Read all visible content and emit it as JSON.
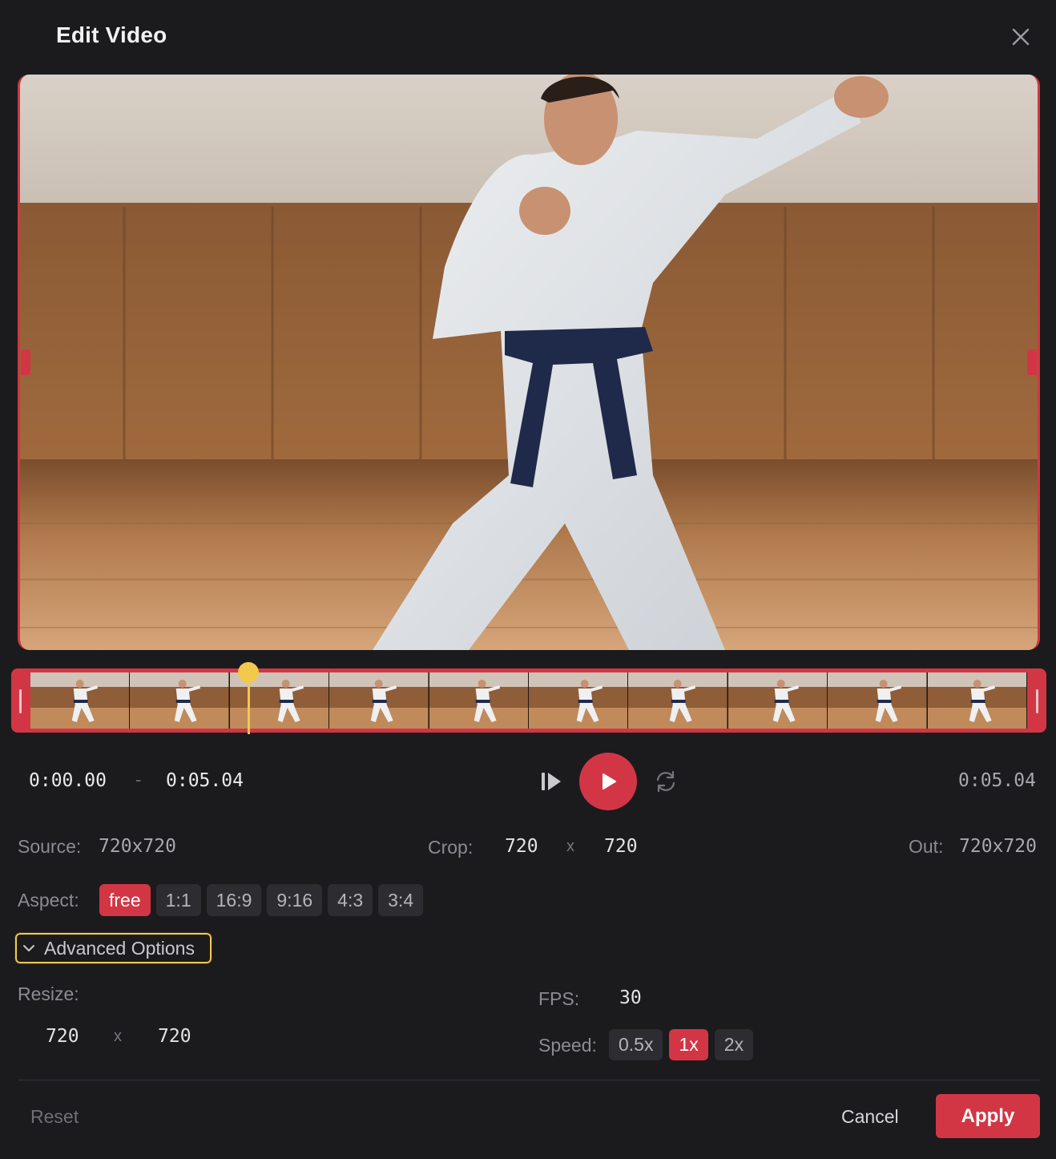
{
  "dialog": {
    "title": "Edit Video",
    "close_icon": "close-icon"
  },
  "playback": {
    "start_time": "0:00.00",
    "range_separator": "-",
    "end_time": "0:05.04",
    "total_duration": "0:05.04",
    "playhead_fraction": 0.22
  },
  "timeline": {
    "frame_count": 10
  },
  "info": {
    "source_label": "Source:",
    "source_value": "720x720",
    "crop_label": "Crop:",
    "crop_width": "720",
    "crop_separator": "x",
    "crop_height": "720",
    "out_label": "Out:",
    "out_value": "720x720"
  },
  "aspect": {
    "label": "Aspect:",
    "options": [
      "free",
      "1:1",
      "16:9",
      "9:16",
      "4:3",
      "3:4"
    ],
    "selected": "free"
  },
  "advanced": {
    "toggle_label": "Advanced Options",
    "expanded": true,
    "resize_label": "Resize:",
    "resize_width": "720",
    "resize_separator": "x",
    "resize_height": "720",
    "fps_label": "FPS:",
    "fps_value": "30",
    "speed_label": "Speed:",
    "speed_options": [
      "0.5x",
      "1x",
      "2x"
    ],
    "speed_selected": "1x"
  },
  "footer": {
    "reset_label": "Reset",
    "cancel_label": "Cancel",
    "apply_label": "Apply"
  },
  "colors": {
    "accent": "#d23644",
    "playhead": "#f2c94c",
    "background": "#1b1b1e"
  }
}
